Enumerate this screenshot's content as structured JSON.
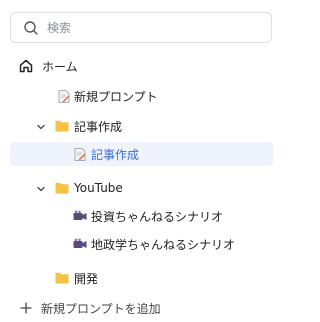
{
  "search": {
    "placeholder": "検索",
    "value": ""
  },
  "home": {
    "label": "ホーム"
  },
  "tree": {
    "new_prompt": "新規プロンプト",
    "folder1": {
      "label": "記事作成",
      "child": "記事作成"
    },
    "folder2": {
      "label": "YouTube",
      "children": [
        "投資ちゃんねるシナリオ",
        "地政学ちゃんねるシナリオ"
      ]
    },
    "folder3": {
      "label": "開発"
    }
  },
  "footer": {
    "add_label": "新規プロンプトを追加"
  },
  "colors": {
    "accent": "#3a6fd8",
    "selected_bg": "#eef3fc",
    "folder": "#f5c242"
  }
}
